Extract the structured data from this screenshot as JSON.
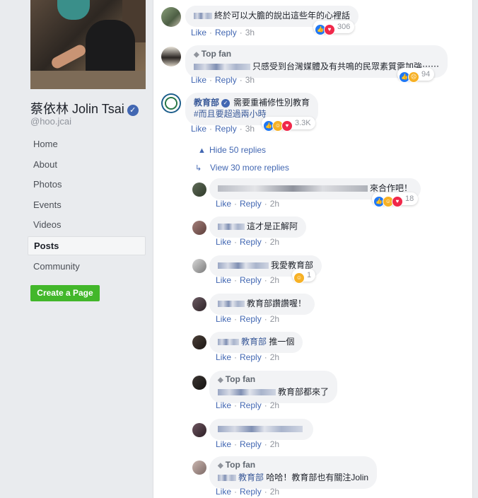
{
  "profile": {
    "name": "蔡依林 Jolin Tsai",
    "handle": "@hoo.jcai",
    "verified_icon": "verified-badge-icon"
  },
  "nav": {
    "items": [
      {
        "label": "Home"
      },
      {
        "label": "About"
      },
      {
        "label": "Photos"
      },
      {
        "label": "Events"
      },
      {
        "label": "Videos"
      },
      {
        "label": "Posts"
      },
      {
        "label": "Community"
      }
    ],
    "active": "Posts",
    "create_page": "Create a Page"
  },
  "colors": {
    "link": "#4267b2",
    "author": "#385898",
    "create_button": "#42b72a",
    "bubble": "#f2f3f5",
    "page_bg": "#e9ebee"
  },
  "actions": {
    "like": "Like",
    "reply": "Reply",
    "sep": "·"
  },
  "comments": [
    {
      "text": "終於可以大膽的說出這些年的心裡話",
      "time": "3h",
      "reacts": [
        "like-icon",
        "love-icon"
      ],
      "count": "306"
    },
    {
      "top_fan": "Top fan",
      "text": "只感受到台灣媒體及有共鳴的民眾素質需加強⋯⋯",
      "time": "3h",
      "reacts": [
        "like-icon",
        "sad-icon"
      ],
      "count": "94"
    },
    {
      "author": "教育部",
      "text": "需要重補修性別教育",
      "text2": "#而且要超過兩小時",
      "time": "3h",
      "reacts": [
        "like-icon",
        "haha-icon",
        "love-icon"
      ],
      "count": "3.3K"
    }
  ],
  "reply_controls": {
    "hide": "Hide 50 replies",
    "view_more": "View 30 more replies"
  },
  "replies": [
    {
      "text": "來合作吧！",
      "time": "2h",
      "reacts": [
        "like-icon",
        "haha-icon",
        "love-icon"
      ],
      "count": "18"
    },
    {
      "text": "這才是正解阿",
      "time": "2h"
    },
    {
      "text": "我愛教育部",
      "time": "2h",
      "reacts": [
        "haha-icon"
      ],
      "count": "1"
    },
    {
      "text": "教育部讚讚喔！",
      "time": "2h"
    },
    {
      "mention": "教育部",
      "text": "推一個",
      "time": "2h"
    },
    {
      "top_fan": "Top fan",
      "text": "教育部都來了",
      "time": "2h"
    },
    {
      "text": "",
      "time": "2h"
    },
    {
      "top_fan": "Top fan",
      "mention": "教育部",
      "text": "哈哈！教育部也有關注Jolin",
      "time": "2h"
    }
  ]
}
